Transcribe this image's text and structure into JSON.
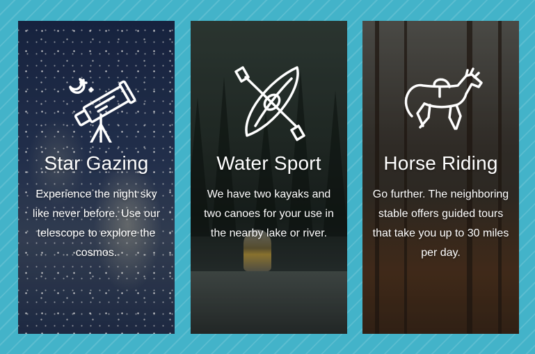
{
  "colors": {
    "page_background": "#43b3c9",
    "card_text": "#ffffff"
  },
  "cards": [
    {
      "icon": "telescope-icon",
      "title": "Star Gazing",
      "description": "Experience the night sky like never before. Use our telescope to explore the cosmos."
    },
    {
      "icon": "kayak-paddle-icon",
      "title": "Water Sport",
      "description": "We have two kayaks and two canoes for your use in the nearby lake or river."
    },
    {
      "icon": "horse-icon",
      "title": "Horse Riding",
      "description": "Go further. The neighboring stable offers guided tours that take you up to 30 miles per day."
    }
  ]
}
